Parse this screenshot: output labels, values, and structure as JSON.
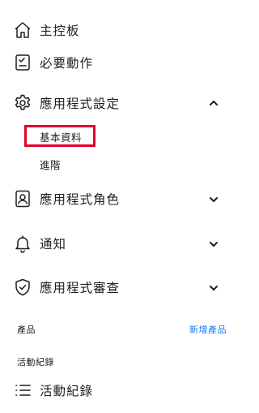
{
  "nav": {
    "dashboard": {
      "label": "主控板",
      "icon": "home-icon"
    },
    "required_actions": {
      "label": "必要動作",
      "icon": "checklist-icon"
    },
    "app_settings": {
      "label": "應用程式設定",
      "icon": "gear-icon",
      "expanded": true,
      "children": [
        {
          "label": "基本資料",
          "selected": true
        },
        {
          "label": "進階",
          "selected": false
        }
      ]
    },
    "app_roles": {
      "label": "應用程式角色",
      "icon": "id-badge-icon",
      "expanded": false
    },
    "notifications": {
      "label": "通知",
      "icon": "bell-icon",
      "expanded": false
    },
    "app_review": {
      "label": "應用程式審查",
      "icon": "shield-check-icon",
      "expanded": false
    }
  },
  "products": {
    "section_label": "產品",
    "add_link": "新增產品"
  },
  "activity": {
    "section_label": "活動紀錄",
    "item_label": "活動紀錄",
    "icon": "list-icon"
  },
  "colors": {
    "text": "#1c1e21",
    "link": "#1877f2",
    "highlight": "#e4002b"
  }
}
